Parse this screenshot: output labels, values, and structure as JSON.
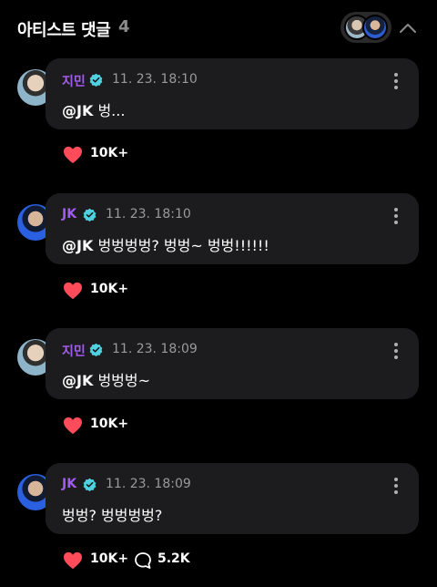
{
  "header": {
    "title": "아티스트 댓글",
    "count": "4"
  },
  "comments": [
    {
      "author": "지민",
      "time": "11. 23. 18:10",
      "mention": "@JK",
      "text": " 벙...",
      "likes": "10K+"
    },
    {
      "author": "JK",
      "time": "11. 23. 18:10",
      "mention": "@JK",
      "text": " 벙벙벙벙? 벙벙~ 벙벙!!!!!!",
      "likes": "10K+"
    },
    {
      "author": "지민",
      "time": "11. 23. 18:09",
      "mention": "@JK",
      "text": " 벙벙벙~",
      "likes": "10K+"
    },
    {
      "author": "JK",
      "time": "11. 23. 18:09",
      "mention": "",
      "text": "벙벙? 벙벙벙벙?",
      "likes": "10K+",
      "replies": "5.2K"
    }
  ],
  "colors": {
    "author": "#a35cf0",
    "verified": "#4fd1e0",
    "heart": "#ff4b5a",
    "bubble": "#1c1c1e"
  },
  "icons": {
    "verified": "verified-badge-icon",
    "more": "more-vertical-icon",
    "like": "heart-icon",
    "reply": "reply-bubble-icon",
    "collapse": "chevron-up-icon"
  }
}
